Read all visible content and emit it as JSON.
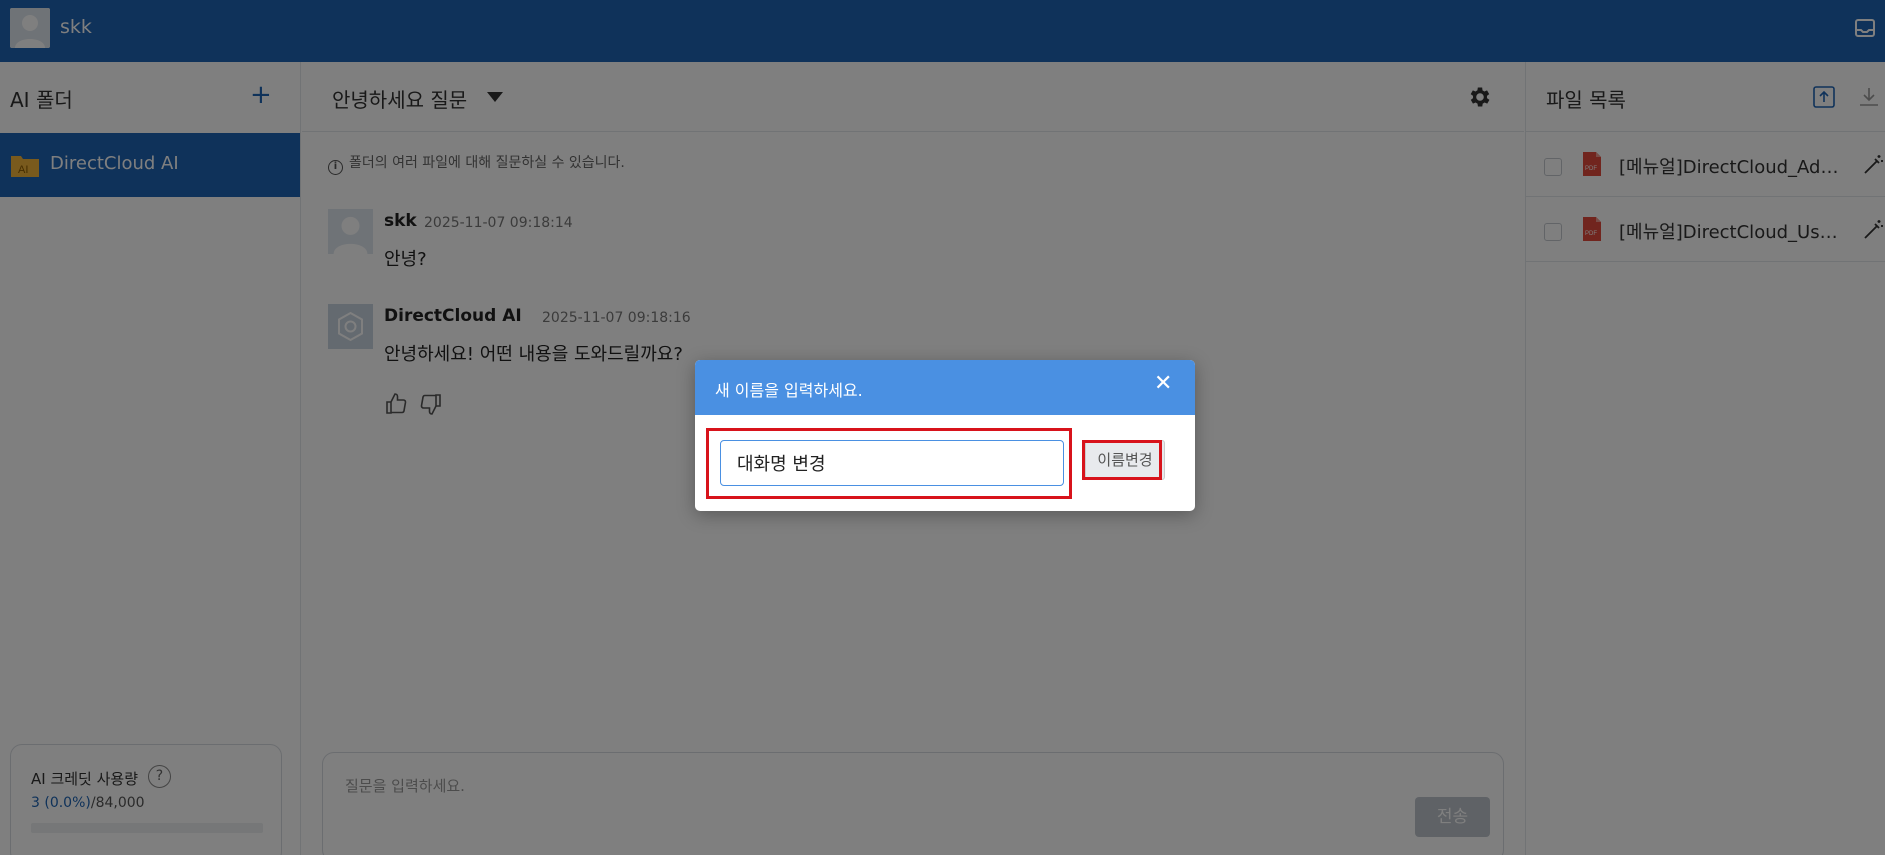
{
  "topbar": {
    "username": "skk"
  },
  "left_panel": {
    "title": "AI 폴더",
    "add_label": "+",
    "folders": [
      {
        "label": "DirectCloud AI"
      }
    ],
    "credit": {
      "title": "AI 크레딧 사용량",
      "help": "?",
      "used": "3 (0.0%)",
      "total": "/84,000",
      "fraction": 0.0
    }
  },
  "center": {
    "chat_title": "안녕하세요 질문",
    "info": "폴더의 여러 파일에 대해 질문하실 수 있습니다.",
    "messages": [
      {
        "name": "skk",
        "time": "2025-11-07 09:18:14",
        "text": "안녕?"
      },
      {
        "name": "DirectCloud AI",
        "time": "2025-11-07 09:18:16",
        "text": "안녕하세요! 어떤 내용을 도와드릴까요?"
      }
    ],
    "input_placeholder": "질문을 입력하세요.",
    "send_label": "전송"
  },
  "right_panel": {
    "title": "파일 목록",
    "files": [
      {
        "name": "[메뉴얼]DirectCloud_Admin_Manual.pdf"
      },
      {
        "name": "[메뉴얼]DirectCloud_User_Manual.pdf"
      }
    ]
  },
  "modal": {
    "title": "새 이름을 입력하세요.",
    "close": "✕",
    "input_value": "대화명 변경",
    "button_label": "이름변경"
  },
  "colors": {
    "brand": "#1e64b4",
    "modal_header": "#4a90e2",
    "highlight": "#d8131b"
  }
}
